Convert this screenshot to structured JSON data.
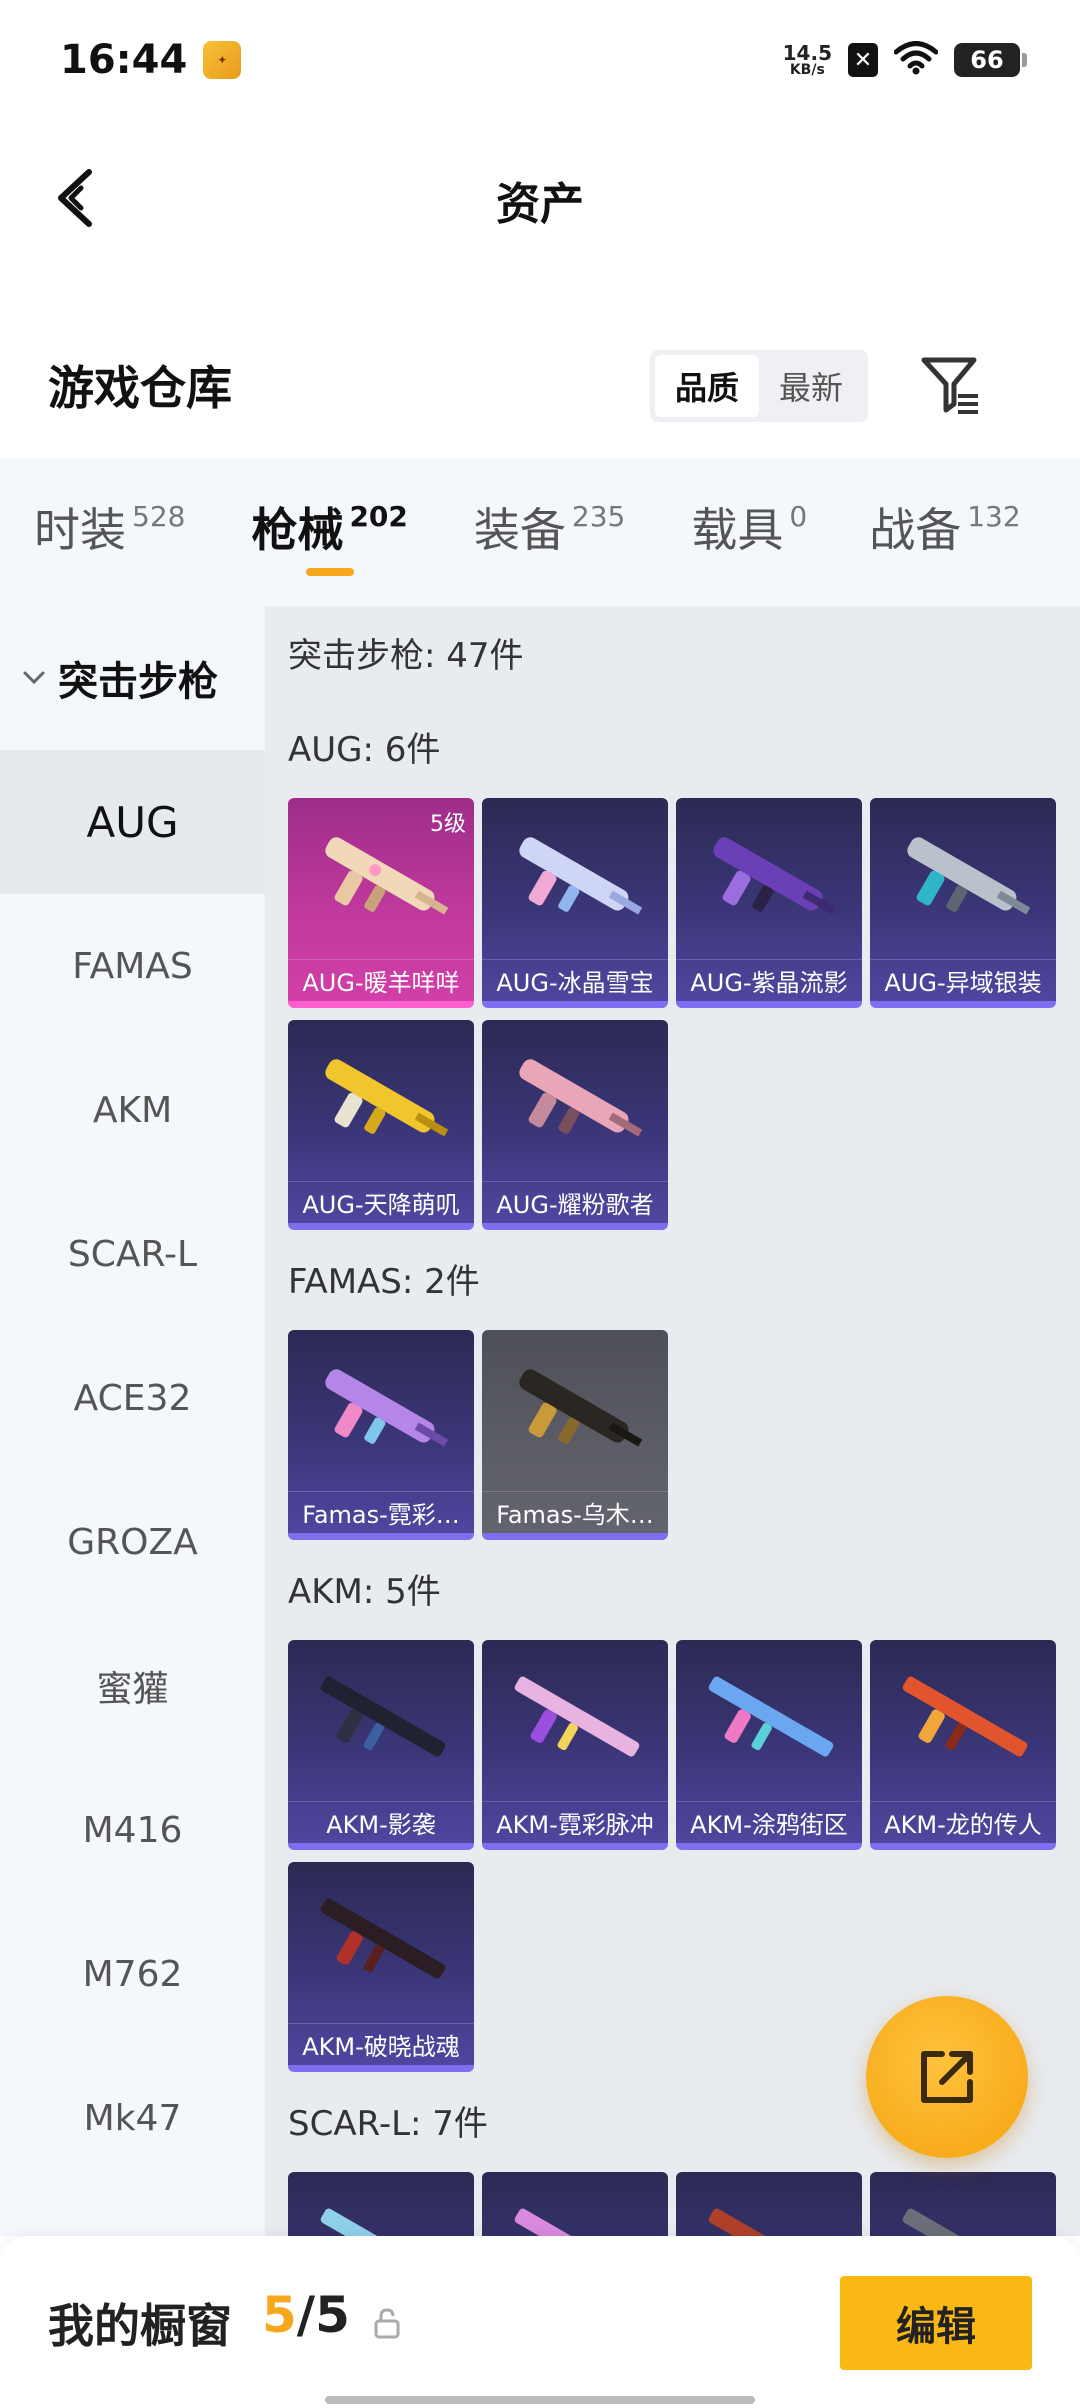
{
  "status_bar": {
    "time": "16:44",
    "net_speed_value": "14.5",
    "net_speed_unit": "KB/s",
    "battery": "66"
  },
  "header": {
    "title": "资产"
  },
  "section": {
    "title": "游戏仓库",
    "sort_options": [
      "品质",
      "最新"
    ],
    "active_sort": "品质"
  },
  "tabs": [
    {
      "label": "时装",
      "count": "528"
    },
    {
      "label": "枪械",
      "count": "202",
      "active": true
    },
    {
      "label": "装备",
      "count": "235"
    },
    {
      "label": "载具",
      "count": "0"
    },
    {
      "label": "战备",
      "count": "132"
    }
  ],
  "sidebar": {
    "group": "突击步枪",
    "items": [
      "AUG",
      "FAMAS",
      "AKM",
      "SCAR-L",
      "ACE32",
      "GROZA",
      "蜜獾",
      "M416",
      "M762",
      "Mk47"
    ],
    "active": "AUG"
  },
  "content": {
    "total": "突击步枪: 47件",
    "groups": [
      {
        "title": "AUG: 6件",
        "items": [
          "AUG-暖羊咩咩",
          "AUG-冰晶雪宝",
          "AUG-紫晶流影",
          "AUG-异域银装",
          "AUG-天降萌叽",
          "AUG-耀粉歌者"
        ]
      },
      {
        "title": "FAMAS: 2件",
        "items": [
          "Famas-霓彩…",
          "Famas-乌木…"
        ]
      },
      {
        "title": "AKM: 5件",
        "items": [
          "AKM-影袭",
          "AKM-霓彩脉冲",
          "AKM-涂鸦街区",
          "AKM-龙的传人",
          "AKM-破晓战魂"
        ]
      },
      {
        "title": "SCAR-L: 7件",
        "items": [
          "",
          "",
          "",
          ""
        ]
      }
    ],
    "first_item_level": "5级"
  },
  "bottom": {
    "label": "我的橱窗",
    "current": "5",
    "separator": "/",
    "total": "5",
    "edit_label": "编辑"
  }
}
